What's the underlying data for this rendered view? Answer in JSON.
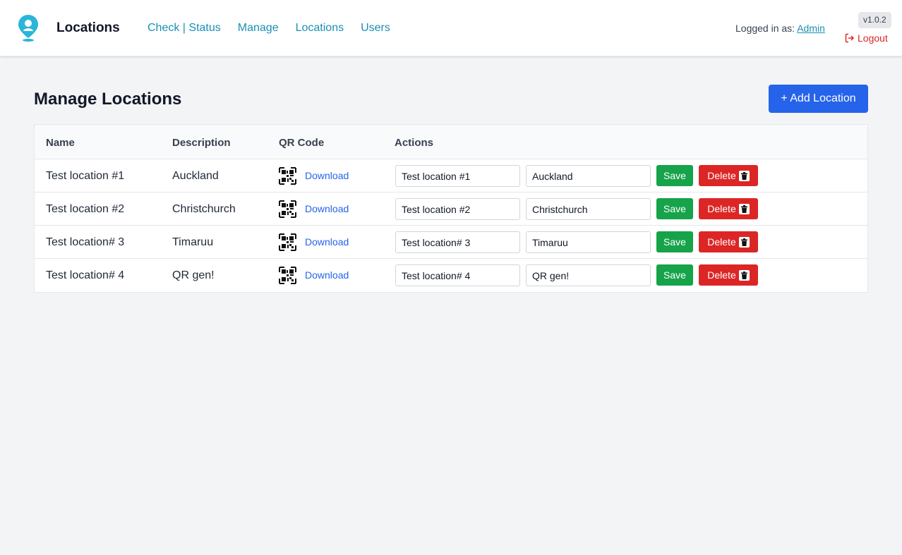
{
  "header": {
    "app_title": "Locations",
    "nav": [
      "Check | Status",
      "Manage",
      "Locations",
      "Users"
    ],
    "logged_in_label": "Logged in as:",
    "user": "Admin",
    "version": "v1.0.2",
    "logout_label": "Logout",
    "logo_icon": "location-pin-icon",
    "accent_color": "#1b8fb3"
  },
  "main": {
    "title": "Manage Locations",
    "add_button": "+ Add Location",
    "columns": [
      "Name",
      "Description",
      "QR Code",
      "Actions"
    ],
    "rows": [
      {
        "name": "Test location #1",
        "description": "Auckland",
        "download": "Download",
        "name_value": "Test location #1",
        "desc_value": "Auckland",
        "save": "Save",
        "delete": "Delete"
      },
      {
        "name": "Test location #2",
        "description": "Christchurch",
        "download": "Download",
        "name_value": "Test location #2",
        "desc_value": "Christchurch",
        "save": "Save",
        "delete": "Delete"
      },
      {
        "name": "Test location# 3",
        "description": "Timaruu",
        "download": "Download",
        "name_value": "Test location# 3",
        "desc_value": "Timaruu",
        "save": "Save",
        "delete": "Delete"
      },
      {
        "name": "Test location# 4",
        "description": "QR gen!",
        "download": "Download",
        "name_value": "Test location# 4",
        "desc_value": "QR gen!",
        "save": "Save",
        "delete": "Delete"
      }
    ]
  },
  "colors": {
    "primary": "#2563eb",
    "save": "#16a34a",
    "delete": "#dc2626",
    "background": "#f3f4f6"
  }
}
